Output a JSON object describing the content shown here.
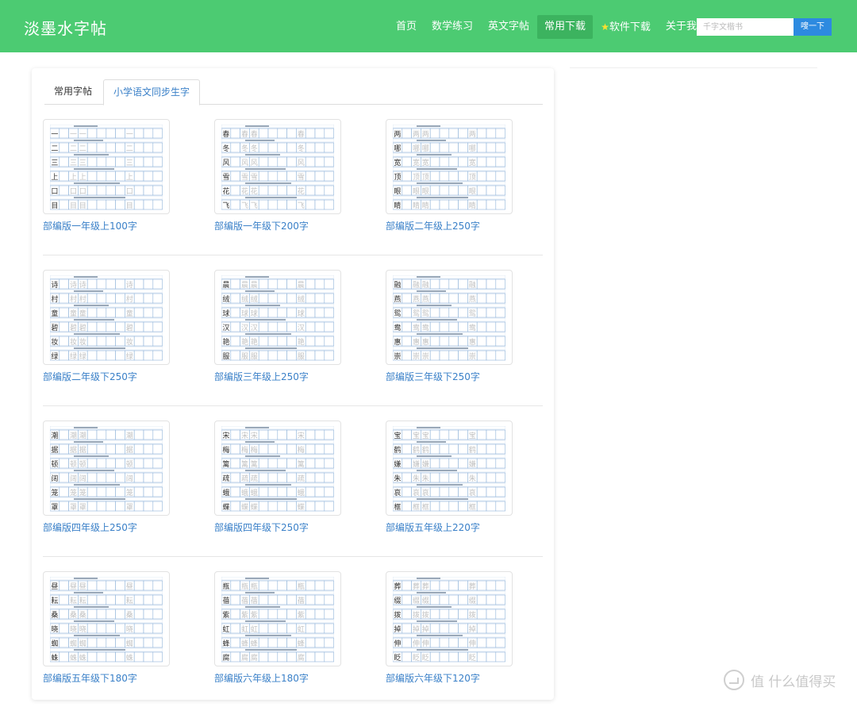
{
  "brand": "淡墨水字帖",
  "nav": {
    "items": [
      {
        "label": "首页",
        "active": false
      },
      {
        "label": "数学练习",
        "active": false
      },
      {
        "label": "英文字帖",
        "active": false
      },
      {
        "label": "常用下载",
        "active": true
      },
      {
        "label": "软件下载",
        "active": false,
        "icon": "star-icon"
      },
      {
        "label": "关于我",
        "active": false
      }
    ],
    "search_placeholder": "千字文楷书",
    "search_button": "嗖一下"
  },
  "tabs": [
    {
      "label": "常用字帖",
      "active": false
    },
    {
      "label": "小学语文同步生字",
      "active": true
    }
  ],
  "cards": [
    {
      "title": "部编版一年级上100字",
      "chars": [
        "一",
        "二",
        "三",
        "上",
        "口",
        "目"
      ]
    },
    {
      "title": "部编版一年级下200字",
      "chars": [
        "春",
        "冬",
        "风",
        "雪",
        "花",
        "飞"
      ]
    },
    {
      "title": "部编版二年级上250字",
      "chars": [
        "两",
        "哪",
        "宽",
        "顶",
        "眼",
        "睛"
      ]
    },
    {
      "title": "部编版二年级下250字",
      "chars": [
        "诗",
        "村",
        "童",
        "碧",
        "妆",
        "绿"
      ]
    },
    {
      "title": "部编版三年级上250字",
      "chars": [
        "晨",
        "绒",
        "球",
        "汉",
        "艳",
        "服"
      ]
    },
    {
      "title": "部编版三年级下250字",
      "chars": [
        "融",
        "燕",
        "鸳",
        "鸯",
        "惠",
        "崇"
      ]
    },
    {
      "title": "部编版四年级上250字",
      "chars": [
        "潮",
        "据",
        "顿",
        "阔",
        "笼",
        "罩"
      ]
    },
    {
      "title": "部编版四年级下250字",
      "chars": [
        "宋",
        "梅",
        "篱",
        "疏",
        "蛾",
        "蝶"
      ]
    },
    {
      "title": "部编版五年级上220字",
      "chars": [
        "宝",
        "鹤",
        "嫌",
        "朱",
        "哀",
        "框"
      ]
    },
    {
      "title": "部编版五年级下180字",
      "chars": [
        "昼",
        "耘",
        "桑",
        "晓",
        "蜘",
        "蛛"
      ]
    },
    {
      "title": "部编版六年级上180字",
      "chars": [
        "瓶",
        "蓓",
        "紫",
        "虹",
        "蜂",
        "腐"
      ]
    },
    {
      "title": "部编版六年级下120字",
      "chars": [
        "葬",
        "缀",
        "拨",
        "掉",
        "伸",
        "眨"
      ]
    }
  ],
  "watermark": "值 什么值得买",
  "colors": {
    "navbar": "#4ccb72",
    "nav_active": "#3cb35f",
    "search_button": "#2d8ae0",
    "link": "#3a80c8",
    "star": "#ffe12e"
  }
}
